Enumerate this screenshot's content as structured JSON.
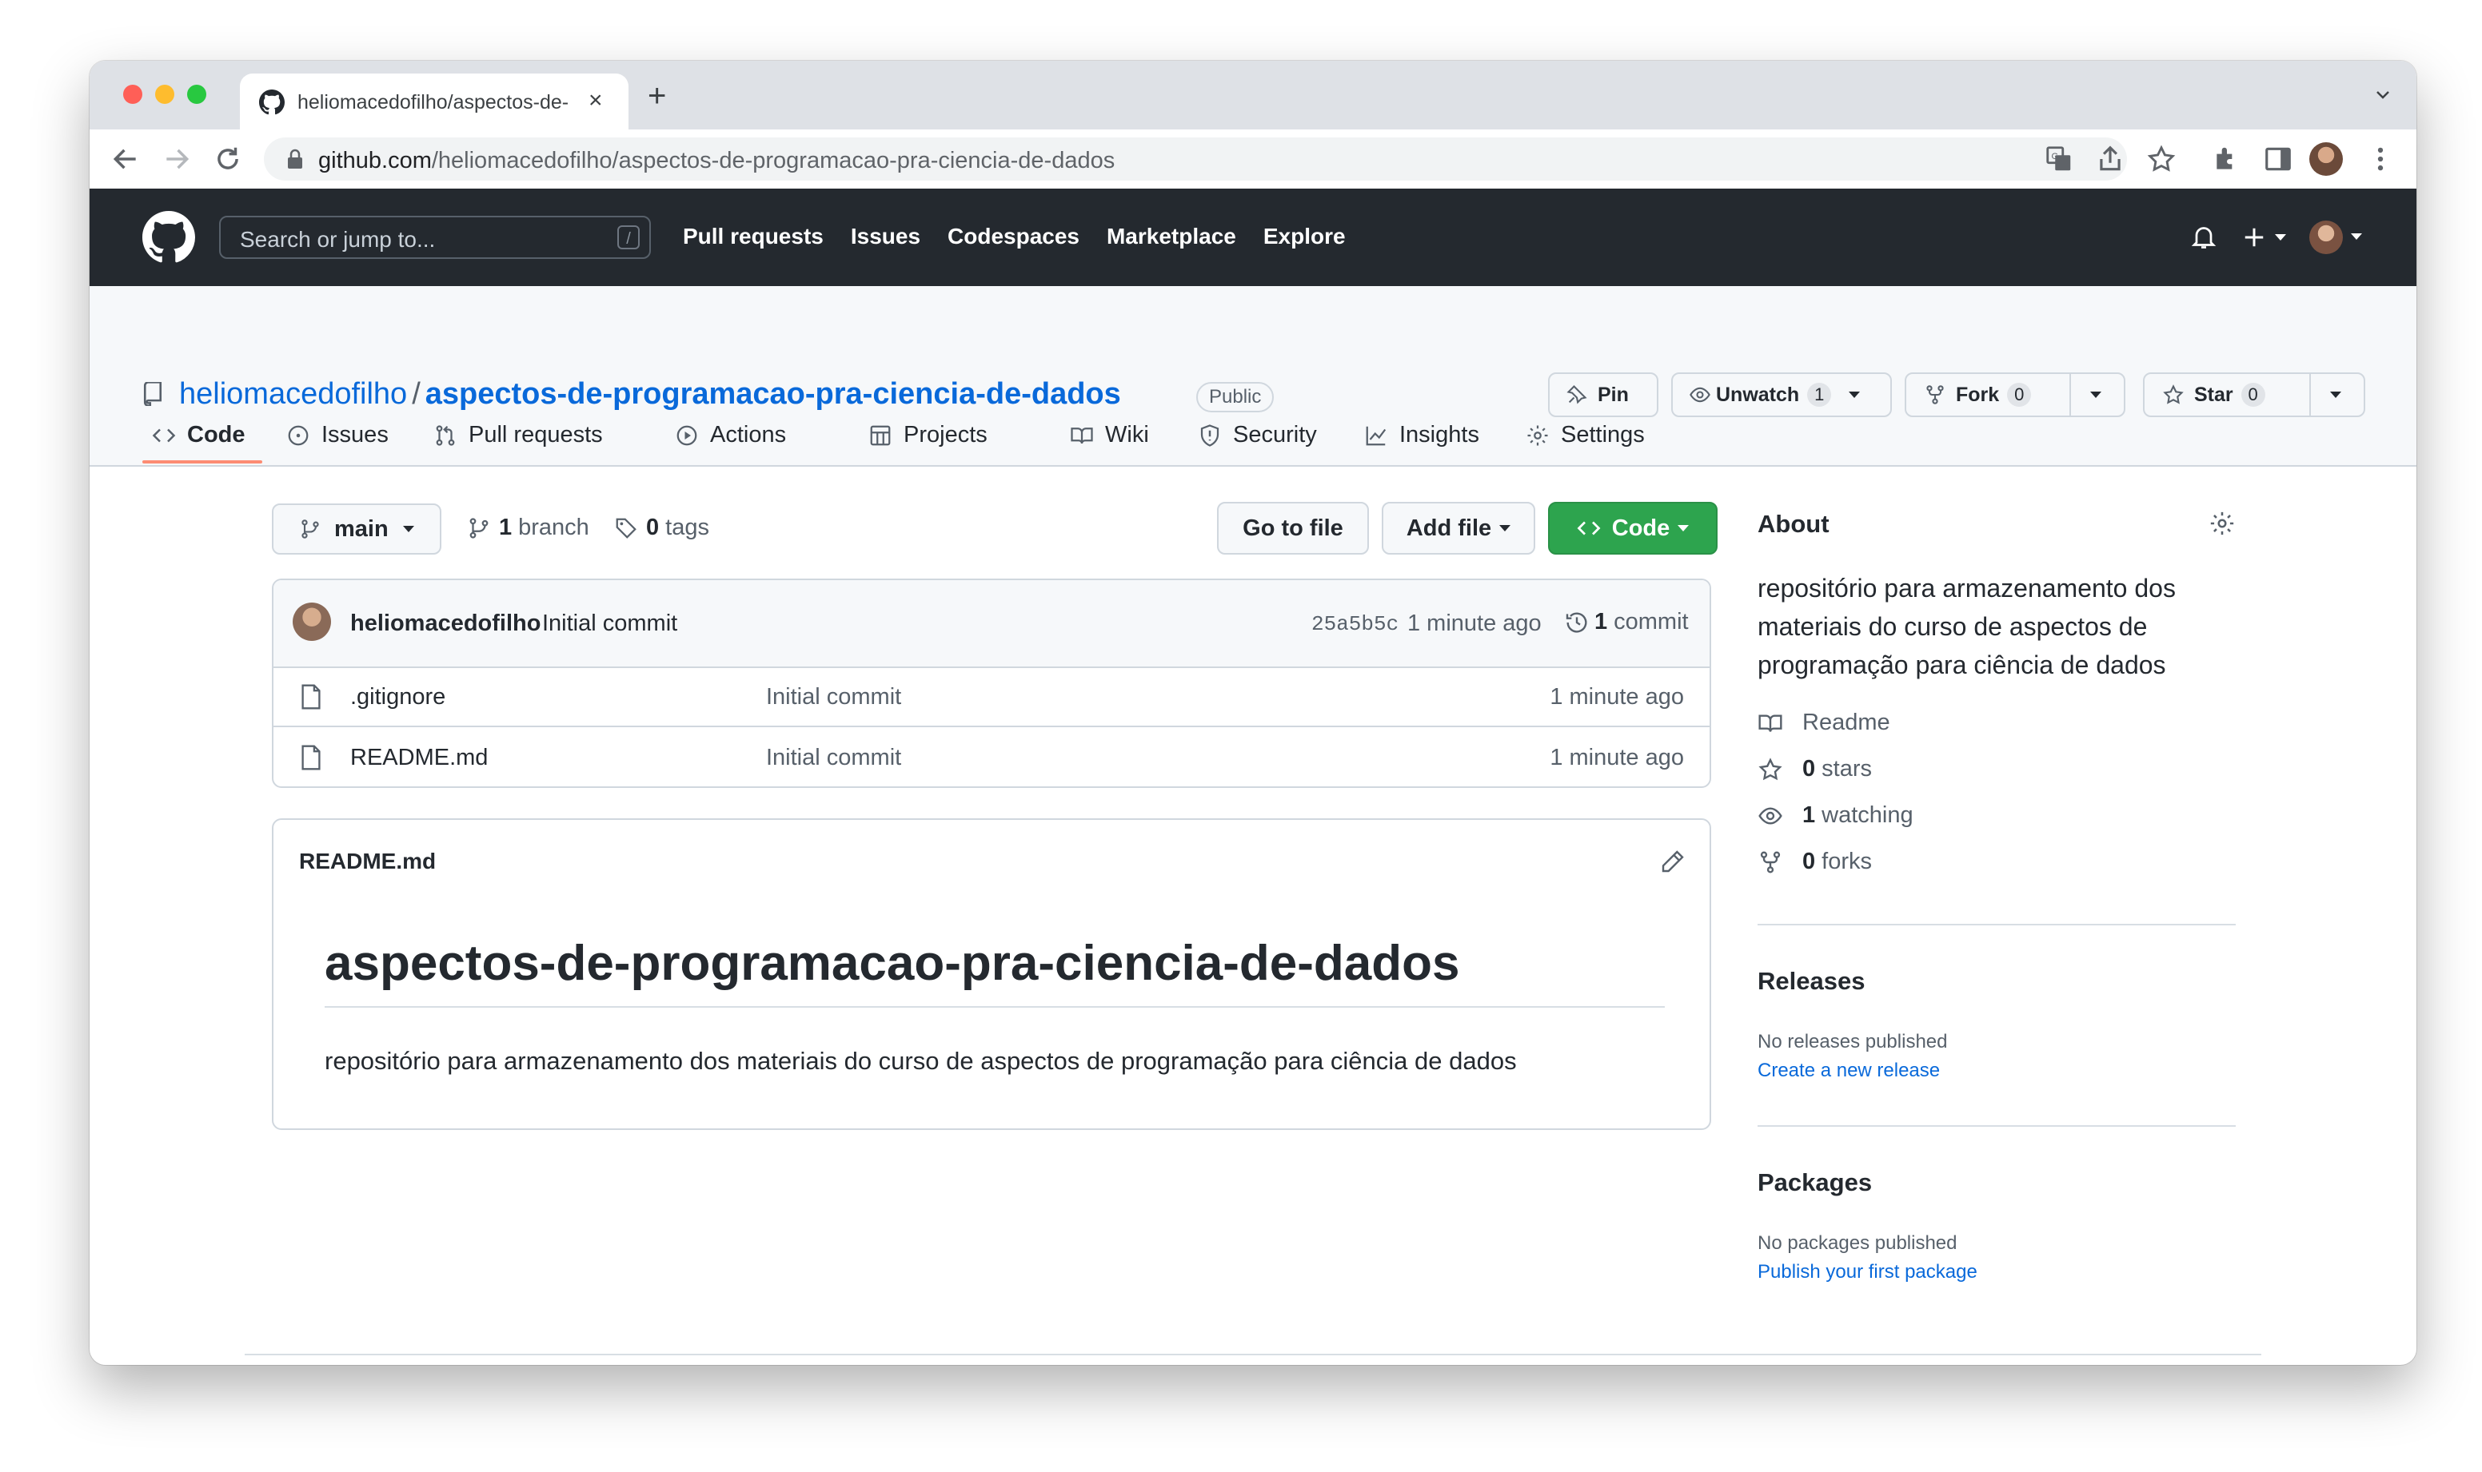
{
  "browser": {
    "tab_title": "heliomacedofilho/aspectos-de-programacao-pra-ciencia-de-dados",
    "tab_close": "×",
    "new_tab": "+",
    "url_host": "github.com",
    "url_path": "/heliomacedofilho/aspectos-de-programacao-pra-ciencia-de-dados"
  },
  "header": {
    "search_placeholder": "Search or jump to...",
    "search_shortcut": "/",
    "nav": [
      "Pull requests",
      "Issues",
      "Codespaces",
      "Marketplace",
      "Explore"
    ]
  },
  "repo": {
    "owner": "heliomacedofilho",
    "separator": "/",
    "name": "aspectos-de-programacao-pra-ciencia-de-dados",
    "visibility": "Public",
    "pin_label": "Pin",
    "watch_label": "Unwatch",
    "watch_count": "1",
    "fork_label": "Fork",
    "fork_count": "0",
    "star_label": "Star",
    "star_count": "0",
    "tabs": [
      "Code",
      "Issues",
      "Pull requests",
      "Actions",
      "Projects",
      "Wiki",
      "Security",
      "Insights",
      "Settings"
    ],
    "active_tab": "Code"
  },
  "toolbar": {
    "branch": "main",
    "branch_count": "1",
    "branch_label": "branch",
    "tag_count": "0",
    "tag_label": "tags",
    "go_to_file": "Go to file",
    "add_file": "Add file",
    "code_label": "Code"
  },
  "latest_commit": {
    "author": "heliomacedofilho",
    "message": "Initial commit",
    "sha": "25a5b5c",
    "time": "1 minute ago",
    "count": "1",
    "count_label": "commit"
  },
  "files": [
    {
      "name": ".gitignore",
      "commit": "Initial commit",
      "age": "1 minute ago"
    },
    {
      "name": "README.md",
      "commit": "Initial commit",
      "age": "1 minute ago"
    }
  ],
  "readme": {
    "label": "README.md",
    "heading": "aspectos-de-programacao-pra-ciencia-de-dados",
    "body": "repositório para armazenamento dos materiais do curso de aspectos de programação para ciência de dados"
  },
  "about": {
    "title": "About",
    "description": "repositório para armazenamento dos materiais do curso de aspectos de programação para ciência de dados",
    "readme": "Readme",
    "stars_count": "0",
    "stars_label": "stars",
    "watching_count": "1",
    "watching_label": "watching",
    "forks_count": "0",
    "forks_label": "forks"
  },
  "releases": {
    "title": "Releases",
    "empty": "No releases published",
    "link": "Create a new release"
  },
  "packages": {
    "title": "Packages",
    "empty": "No packages published",
    "link": "Publish your first package"
  },
  "colors": {
    "header_bg": "#24292f",
    "link": "#0969da",
    "code_button": "#2da44e",
    "active_tab_underline": "#fd8c73"
  }
}
